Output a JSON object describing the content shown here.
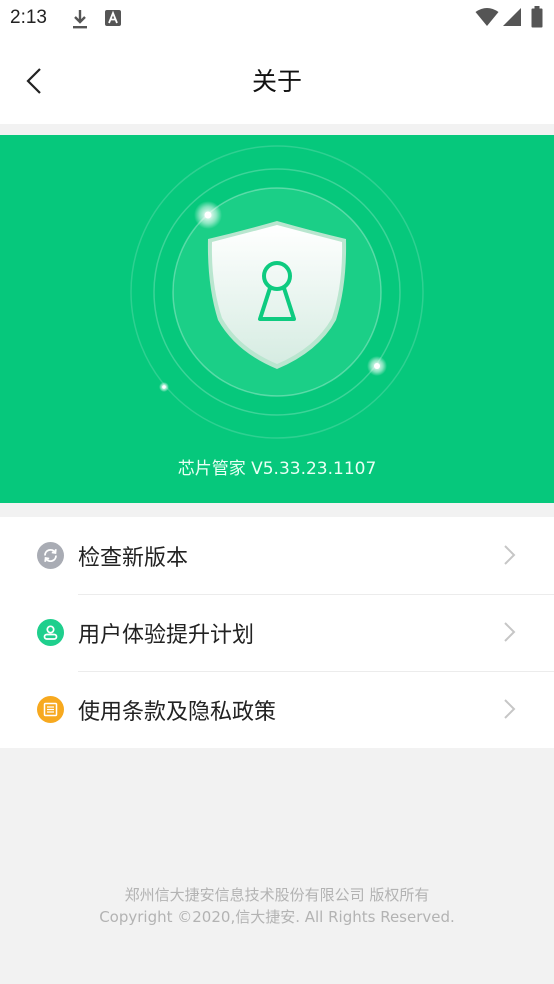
{
  "status_bar": {
    "time": "2:13"
  },
  "app_bar": {
    "title": "关于"
  },
  "hero": {
    "version_text": "芯片管家 V5.33.23.1107"
  },
  "menu": {
    "items": [
      {
        "label": "检查新版本",
        "icon": "refresh-icon",
        "icon_color": "#a9acb4"
      },
      {
        "label": "用户体验提升计划",
        "icon": "user-icon",
        "icon_color": "#1fcf8d"
      },
      {
        "label": "使用条款及隐私政策",
        "icon": "document-icon",
        "icon_color": "#f7a91f"
      }
    ]
  },
  "footer": {
    "line1": "郑州信大捷安信息技术股份有限公司 版权所有",
    "line2": "Copyright ©2020,信大捷安. All Rights Reserved."
  },
  "colors": {
    "accent": "#06c87c",
    "background": "#f2f2f2"
  }
}
